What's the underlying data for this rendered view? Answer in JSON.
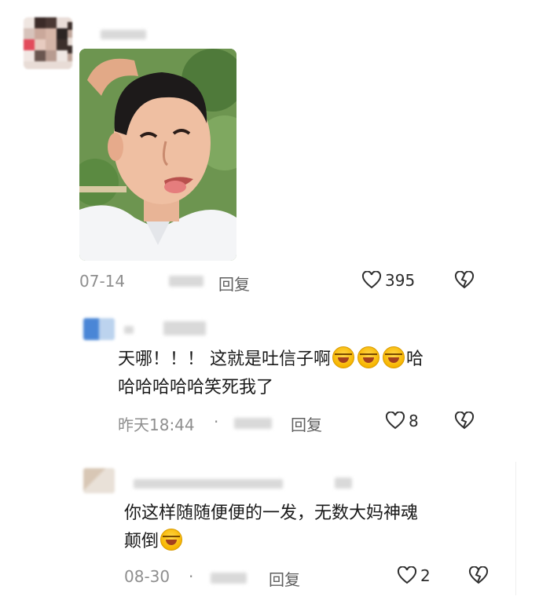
{
  "post": {
    "date": "07-14",
    "reply_label": "回复",
    "like_count": "395"
  },
  "comments": [
    {
      "text_line1": "天哪！！！ 这就是吐信子啊",
      "text_line1_tail": "哈",
      "text_line2": "哈哈哈哈哈笑死我了",
      "time": "昨天18:44",
      "dot": "·",
      "reply_label": "回复",
      "like_count": "8"
    },
    {
      "text_line1": "你这样随随便便的一发，无数大妈神魂",
      "text_line2": "颠倒",
      "date": "08-30",
      "dot": "·",
      "reply_label": "回复",
      "like_count": "2"
    }
  ]
}
